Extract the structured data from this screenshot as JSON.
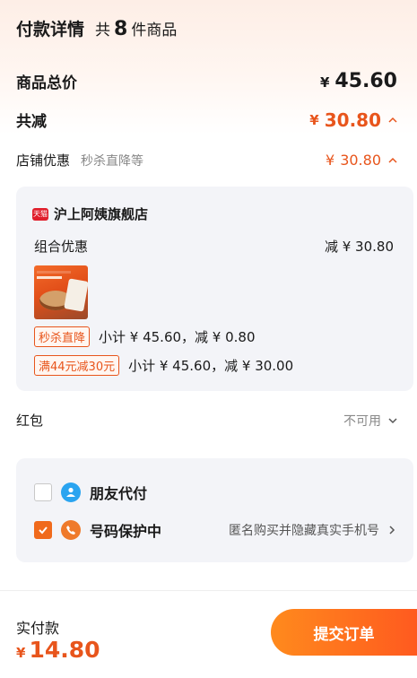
{
  "header": {
    "title": "付款详情",
    "count_prefix": "共",
    "count": "8",
    "count_suffix": "件商品"
  },
  "summary": {
    "total_label": "商品总价",
    "total_currency": "¥",
    "total_value": "45.60",
    "reduce_label": "共减",
    "reduce_currency": "¥",
    "reduce_value": "30.80"
  },
  "store_promo": {
    "label": "店铺优惠",
    "sub": "秒杀直降等",
    "currency": "¥",
    "value": "30.80"
  },
  "store": {
    "badge": "天猫",
    "name": "沪上阿姨旗舰店",
    "combo_label": "组合优惠",
    "combo_value": "减 ¥ 30.80",
    "promos": [
      {
        "tag": "秒杀直降",
        "text": "小计 ¥ 45.60，减 ¥ 0.80"
      },
      {
        "tag": "满44元减30元",
        "text": "小计 ¥ 45.60，减 ¥ 30.00"
      }
    ]
  },
  "hongbao": {
    "label": "红包",
    "value": "不可用"
  },
  "options": {
    "friend_pay": {
      "label": "朋友代付",
      "checked": false
    },
    "privacy": {
      "label": "号码保护中",
      "desc": "匿名购买并隐藏真实手机号",
      "checked": true
    }
  },
  "footer": {
    "pay_label": "实付款",
    "currency": "¥",
    "amount": "14.80",
    "submit_label": "提交订单"
  },
  "colors": {
    "accent": "#e8551c",
    "button": "#ff6a1f",
    "card": "#f3f4f8"
  }
}
